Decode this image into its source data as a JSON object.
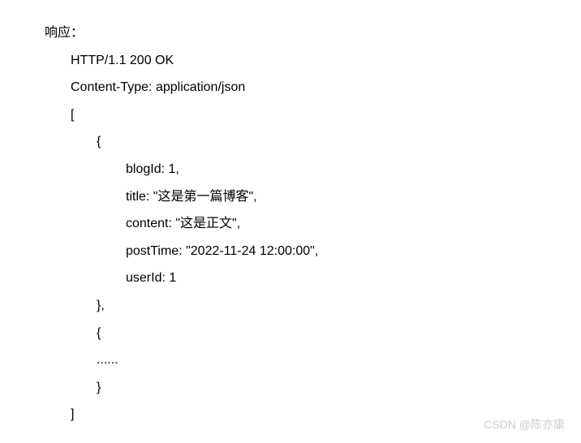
{
  "header": {
    "label": "响应："
  },
  "lines": {
    "statusLine": "HTTP/1.1 200 OK",
    "contentType": "Content-Type: application/json",
    "arrayOpen": "[",
    "objOpen": "{",
    "blogId": "blogId: 1,",
    "title": "title: \"这是第一篇博客\",",
    "content": "content: \"这是正文\",",
    "postTime": "postTime: \"2022-11-24 12:00:00\",",
    "userId": "userId: 1",
    "objClose1": "},",
    "objOpen2": "{",
    "ellipsis": "......",
    "objClose2": "}",
    "arrayClose": "]"
  },
  "watermark": "CSDN @陈亦康"
}
